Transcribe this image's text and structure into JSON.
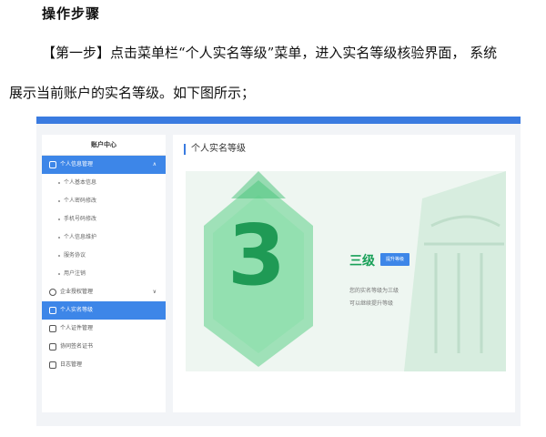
{
  "document": {
    "heading": "操作步骤",
    "para_line1": "【第一步】点击菜单栏“个人实名等级”菜单，进入实名等级核验界面， 系统",
    "para_line2": "展示当前账户的实名等级。如下图所示；"
  },
  "screenshot": {
    "sidebar": {
      "title": "账户中心",
      "items": [
        {
          "label": "个人信息管理",
          "type": "group",
          "icon": "user-icon"
        },
        {
          "label": "个人基本信息",
          "type": "sub"
        },
        {
          "label": "个人密码修改",
          "type": "sub"
        },
        {
          "label": "手机号码修改",
          "type": "sub"
        },
        {
          "label": "个人信息维护",
          "type": "sub"
        },
        {
          "label": "服务协议",
          "type": "sub"
        },
        {
          "label": "用户注销",
          "type": "sub"
        },
        {
          "label": "企业授权管理",
          "type": "group",
          "icon": "company-icon"
        },
        {
          "label": "个人实名等级",
          "type": "active",
          "icon": "shield-icon"
        },
        {
          "label": "个人证件管理",
          "type": "group",
          "icon": "id-card-icon"
        },
        {
          "label": "协同签名证书",
          "type": "group",
          "icon": "certificate-icon"
        },
        {
          "label": "日志管理",
          "type": "group",
          "icon": "log-icon"
        }
      ]
    },
    "main": {
      "title": "个人实名等级",
      "level_number": "3",
      "level_text": "三级",
      "upgrade_button": "提升等级",
      "desc_line1": "您的实名等级为三级",
      "desc_line2": "可以继续提升等级"
    },
    "colors": {
      "accent_blue": "#3d86e8",
      "level_green": "#18a058"
    }
  }
}
